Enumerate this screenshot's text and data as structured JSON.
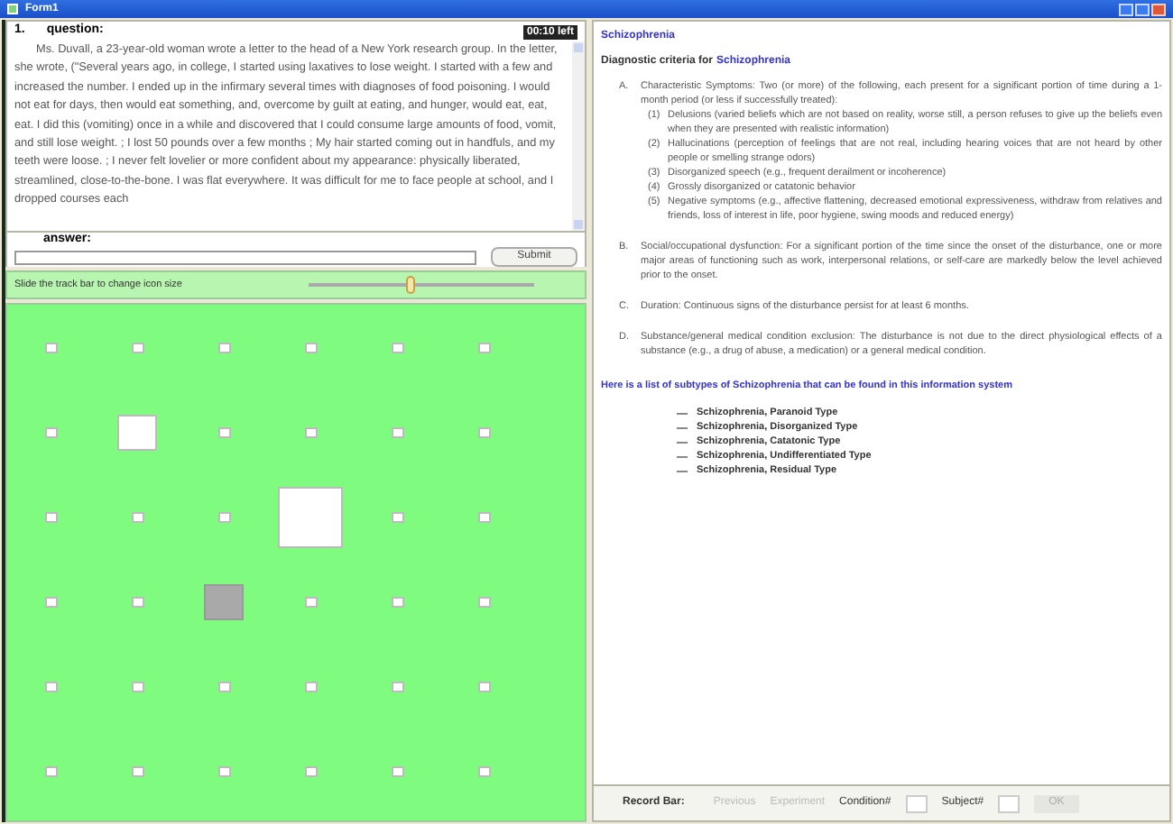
{
  "window": {
    "title": "Form1"
  },
  "question": {
    "number": "1.",
    "label": "question:",
    "timer": "00:10 left",
    "text": "Ms. Duvall, a 23-year-old woman wrote a letter to the head of a New York research group. In the letter, she wrote, (\"Several years ago, in college, I started using laxatives to lose weight. I started with a few and increased the number. I ended up in the infirmary several times with diagnoses of food poisoning. I would not eat for days, then would eat something, and, overcome by guilt at eating, and hunger, would eat, eat, eat. I did this (vomiting) once in a while and discovered that I could consume large amounts of food, vomit, and still lose weight. ; I lost 50 pounds over a few months ; My hair started coming out in handfuls, and my teeth were loose. ; I never felt lovelier or more confident about my appearance: physically liberated, streamlined, close-to-the-bone. I was flat everywhere. It was difficult for me to face people at school, and I dropped courses each"
  },
  "answer": {
    "label": "answer:",
    "submit": "Submit"
  },
  "slider": {
    "label": "Slide the track bar to change icon size",
    "level": 0.45
  },
  "icons": [
    [
      {
        "kind": "small"
      },
      {
        "kind": "small"
      },
      {
        "kind": "small"
      },
      {
        "kind": "small"
      },
      {
        "kind": "small"
      },
      {
        "kind": "small"
      }
    ],
    [
      {
        "kind": "small"
      },
      {
        "kind": "medium"
      },
      {
        "kind": "small"
      },
      {
        "kind": "small"
      },
      {
        "kind": "small"
      },
      {
        "kind": "small"
      }
    ],
    [
      {
        "kind": "small"
      },
      {
        "kind": "small"
      },
      {
        "kind": "small"
      },
      {
        "kind": "large"
      },
      {
        "kind": "small"
      },
      {
        "kind": "small"
      }
    ],
    [
      {
        "kind": "small"
      },
      {
        "kind": "small"
      },
      {
        "kind": "grey"
      },
      {
        "kind": "small"
      },
      {
        "kind": "small"
      },
      {
        "kind": "small"
      }
    ],
    [
      {
        "kind": "small"
      },
      {
        "kind": "small"
      },
      {
        "kind": "small"
      },
      {
        "kind": "small"
      },
      {
        "kind": "small"
      },
      {
        "kind": "small"
      }
    ],
    [
      {
        "kind": "small"
      },
      {
        "kind": "small"
      },
      {
        "kind": "small"
      },
      {
        "kind": "small"
      },
      {
        "kind": "small"
      },
      {
        "kind": "small"
      }
    ]
  ],
  "document": {
    "title": "Schizophrenia",
    "heading": "Diagnostic criteria for",
    "heading_link": "Schizophrenia",
    "criteria": [
      {
        "letter": "A.",
        "text": "Characteristic Symptoms: Two (or more) of the following, each present for a significant portion of time during a 1-month period (or less if successfully treated):",
        "items": [
          {
            "num": "(1)",
            "text": "Delusions (varied beliefs which are not based on reality, worse still, a person refuses to give up the beliefs even when they are presented with realistic information)"
          },
          {
            "num": "(2)",
            "text": "Hallucinations (perception of feelings that are not real, including hearing voices that are not heard by other people or smelling strange odors)"
          },
          {
            "num": "(3)",
            "text": "Disorganized speech (e.g., frequent derailment or incoherence)"
          },
          {
            "num": "(4)",
            "text": "Grossly disorganized or catatonic behavior"
          },
          {
            "num": "(5)",
            "text": "Negative symptoms (e.g., affective flattening, decreased emotional expressiveness, withdraw from relatives and friends, loss of interest in life, poor hygiene, swing moods and reduced energy)"
          }
        ]
      },
      {
        "letter": "B.",
        "text": "Social/occupational dysfunction: For a significant portion of the time since the onset of the disturbance, one or more major areas of functioning such as work, interpersonal relations, or self-care are markedly below the level achieved prior to the onset."
      },
      {
        "letter": "C.",
        "text": "Duration: Continuous signs of the disturbance persist for at least 6 months."
      },
      {
        "letter": "D.",
        "text": "Substance/general medical condition exclusion: The disturbance is not due to the direct physiological effects of a substance (e.g., a drug of abuse, a medication) or a general medical condition."
      }
    ],
    "subtypes_intro": "Here is a list of subtypes of Schizophrenia that can be found in this information system",
    "subtypes": [
      "Schizophrenia, Paranoid Type",
      "Schizophrenia, Disorganized Type",
      "Schizophrenia, Catatonic Type",
      "Schizophrenia, Undifferentiated Type",
      "Schizophrenia, Residual Type"
    ]
  },
  "record_bar": {
    "label": "Record Bar:",
    "buttons": [
      {
        "label": "Previous",
        "disabled": true
      },
      {
        "label": "Experiment",
        "disabled": true
      }
    ],
    "condition_label": "Condition#",
    "subject_label": "Subject#",
    "ok": "OK"
  }
}
